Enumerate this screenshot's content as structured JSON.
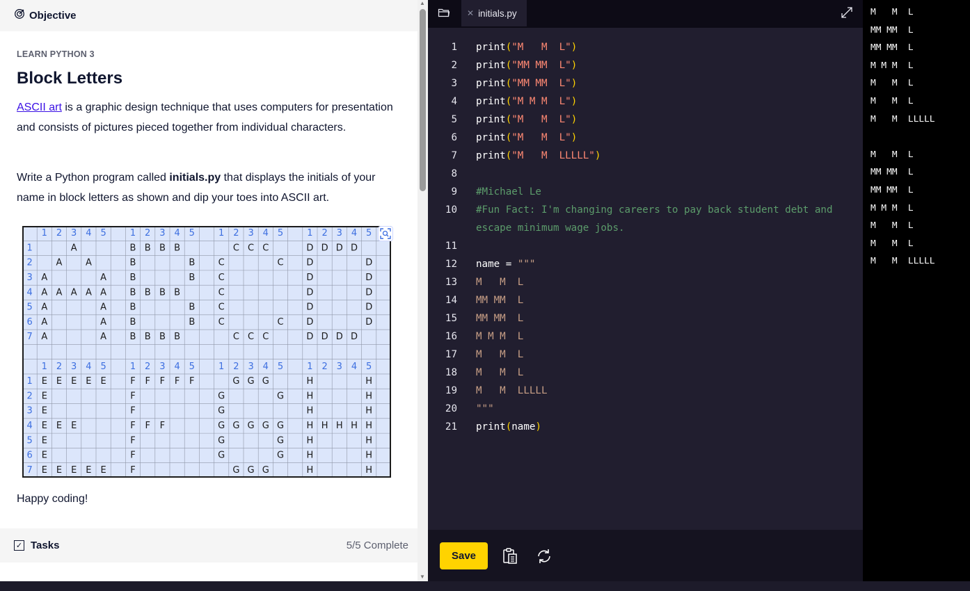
{
  "lesson": {
    "objective_label": "Objective",
    "course": "LEARN PYTHON 3",
    "title": "Block Letters",
    "p1_link": "ASCII art",
    "p1_rest": " is a graphic design technique that uses computers for presentation and consists of pictures pieced together from individual characters.",
    "p2_pre": "Write a Python program called ",
    "p2_bold": "initials.py",
    "p2_post": " that displays the initials of your name in block letters as shown and dip your toes into ASCII art.",
    "closing": "Happy coding!",
    "tasks_label": "Tasks",
    "tasks_status": "5/5 Complete"
  },
  "grid_image": {
    "column_numbers": [
      "1",
      "2",
      "3",
      "4",
      "5"
    ],
    "row_numbers": [
      "1",
      "2",
      "3",
      "4",
      "5",
      "6",
      "7"
    ],
    "blocks": [
      {
        "letter": "A",
        "rows": [
          "  A  ",
          " A A ",
          "A   A",
          "AAAAA",
          "A   A",
          "A   A",
          "A   A"
        ]
      },
      {
        "letter": "B",
        "rows": [
          "BBBB ",
          "B   B",
          "B   B",
          "BBBB ",
          "B   B",
          "B   B",
          "BBBB "
        ]
      },
      {
        "letter": "C",
        "rows": [
          " CCC ",
          "C   C",
          "C    ",
          "C    ",
          "C    ",
          "C   C",
          " CCC "
        ]
      },
      {
        "letter": "D",
        "rows": [
          "DDDD ",
          "D   D",
          "D   D",
          "D   D",
          "D   D",
          "D   D",
          "DDDD "
        ]
      },
      {
        "letter": "E",
        "rows": [
          "EEEEE",
          "E    ",
          "E    ",
          "EEE  ",
          "E    ",
          "E    ",
          "EEEEE"
        ]
      },
      {
        "letter": "F",
        "rows": [
          "FFFFF",
          "F    ",
          "F    ",
          "FFF  ",
          "F    ",
          "F    ",
          "F    "
        ]
      },
      {
        "letter": "G",
        "rows": [
          " GGG ",
          "G   G",
          "G    ",
          "GGGGG",
          "G   G",
          "G   G",
          " GGG "
        ]
      },
      {
        "letter": "H",
        "rows": [
          "H   H",
          "H   H",
          "H   H",
          "HHHHH",
          "H   H",
          "H   H",
          "H   H"
        ]
      }
    ]
  },
  "editor": {
    "tab_name": "initials.py",
    "save_label": "Save",
    "lines": [
      {
        "n": "1",
        "tokens": [
          [
            "kw",
            "print"
          ],
          [
            "p",
            "("
          ],
          [
            "s",
            "\"M   M  L\""
          ],
          [
            "p",
            ")"
          ]
        ]
      },
      {
        "n": "2",
        "tokens": [
          [
            "kw",
            "print"
          ],
          [
            "p",
            "("
          ],
          [
            "s",
            "\"MM MM  L\""
          ],
          [
            "p",
            ")"
          ]
        ]
      },
      {
        "n": "3",
        "tokens": [
          [
            "kw",
            "print"
          ],
          [
            "p",
            "("
          ],
          [
            "s",
            "\"MM MM  L\""
          ],
          [
            "p",
            ")"
          ]
        ]
      },
      {
        "n": "4",
        "tokens": [
          [
            "kw",
            "print"
          ],
          [
            "p",
            "("
          ],
          [
            "s",
            "\"M M M  L\""
          ],
          [
            "p",
            ")"
          ]
        ]
      },
      {
        "n": "5",
        "tokens": [
          [
            "kw",
            "print"
          ],
          [
            "p",
            "("
          ],
          [
            "s",
            "\"M   M  L\""
          ],
          [
            "p",
            ")"
          ]
        ]
      },
      {
        "n": "6",
        "tokens": [
          [
            "kw",
            "print"
          ],
          [
            "p",
            "("
          ],
          [
            "s",
            "\"M   M  L\""
          ],
          [
            "p",
            ")"
          ]
        ]
      },
      {
        "n": "7",
        "tokens": [
          [
            "kw",
            "print"
          ],
          [
            "p",
            "("
          ],
          [
            "s",
            "\"M   M  LLLLL\""
          ],
          [
            "p",
            ")"
          ]
        ]
      },
      {
        "n": "8",
        "tokens": []
      },
      {
        "n": "9",
        "tokens": [
          [
            "cm",
            "#Michael Le"
          ]
        ]
      },
      {
        "n": "10",
        "tokens": [
          [
            "cm",
            "#Fun Fact: I'm changing careers to pay back student debt and"
          ]
        ]
      },
      {
        "n": "",
        "tokens": [
          [
            "cm",
            "escape minimum wage jobs."
          ]
        ]
      },
      {
        "n": "11",
        "tokens": []
      },
      {
        "n": "12",
        "tokens": [
          [
            "id",
            "name "
          ],
          [
            "kw",
            "= "
          ],
          [
            "ms",
            "\"\"\""
          ]
        ]
      },
      {
        "n": "13",
        "tokens": [
          [
            "ms",
            "M   M  L"
          ]
        ]
      },
      {
        "n": "14",
        "tokens": [
          [
            "ms",
            "MM MM  L"
          ]
        ]
      },
      {
        "n": "15",
        "tokens": [
          [
            "ms",
            "MM MM  L"
          ]
        ]
      },
      {
        "n": "16",
        "tokens": [
          [
            "ms",
            "M M M  L"
          ]
        ]
      },
      {
        "n": "17",
        "tokens": [
          [
            "ms",
            "M   M  L"
          ]
        ]
      },
      {
        "n": "18",
        "tokens": [
          [
            "ms",
            "M   M  L"
          ]
        ]
      },
      {
        "n": "19",
        "tokens": [
          [
            "ms",
            "M   M  LLLLL"
          ]
        ]
      },
      {
        "n": "20",
        "tokens": [
          [
            "ms",
            "\"\"\""
          ]
        ]
      },
      {
        "n": "21",
        "tokens": [
          [
            "kw",
            "print"
          ],
          [
            "p",
            "("
          ],
          [
            "id",
            "name"
          ],
          [
            "p",
            ")"
          ]
        ]
      }
    ]
  },
  "terminal": {
    "lines": [
      "M   M  L",
      "MM MM  L",
      "MM MM  L",
      "M M M  L",
      "M   M  L",
      "M   M  L",
      "M   M  LLLLL",
      "",
      "M   M  L",
      "MM MM  L",
      "MM MM  L",
      "M M M  L",
      "M   M  L",
      "M   M  L",
      "M   M  LLLLL"
    ]
  },
  "icons": {
    "objective": "target-icon",
    "folder": "folder-icon",
    "close_tab": "close-icon",
    "expand": "expand-icon",
    "clipboard": "clipboard-icon",
    "reset": "refresh-icon",
    "zoom": "zoom-icon",
    "tasks_check": "checkbox-icon"
  },
  "colors": {
    "accent_yellow": "#ffd300",
    "link": "#3a10e5",
    "grid_bg": "#dce6fb",
    "grid_number": "#3d6fe0"
  }
}
